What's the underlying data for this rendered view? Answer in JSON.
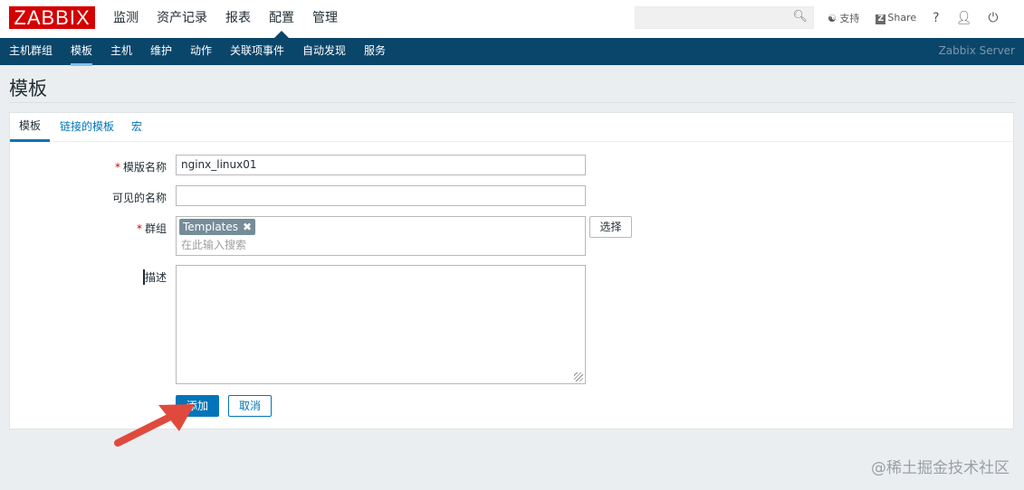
{
  "header": {
    "logo": "ZABBIX",
    "menu": [
      "监测",
      "资产记录",
      "报表",
      "配置",
      "管理"
    ],
    "active_menu": "配置",
    "search_placeholder": "",
    "support": "支持",
    "share": "Share",
    "help": "?"
  },
  "nav": {
    "items": [
      "主机群组",
      "模板",
      "主机",
      "维护",
      "动作",
      "关联项事件",
      "自动发现",
      "服务"
    ],
    "active": "模板",
    "server": "Zabbix Server"
  },
  "page": {
    "title": "模板"
  },
  "tabs": [
    "模板",
    "链接的模板",
    "宏"
  ],
  "form": {
    "template_name_label": "模版名称",
    "template_name_value": "nginx_linux01",
    "visible_name_label": "可见的名称",
    "visible_name_value": "",
    "groups_label": "群组",
    "group_chip": "Templates",
    "groups_placeholder": "在此输入搜索",
    "select_button": "选择",
    "description_label": "描述",
    "description_value": "",
    "required_mark": "*",
    "add_button": "添加",
    "cancel_button": "取消"
  },
  "annotation": {
    "arrow_color": "#e04a3c"
  },
  "watermark": "@稀土掘金技术社区"
}
